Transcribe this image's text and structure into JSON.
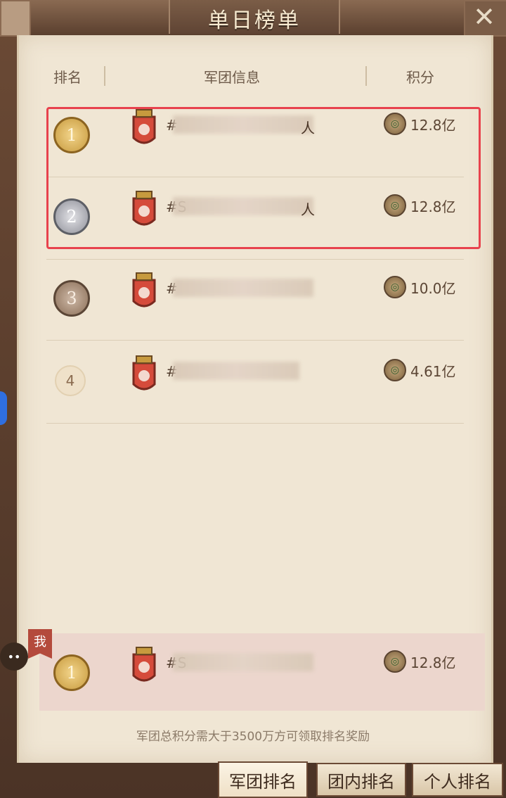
{
  "title": "单日榜单",
  "close_icon": "close-icon",
  "columns": {
    "rank": "排名",
    "info": "军团信息",
    "score": "积分"
  },
  "rows": [
    {
      "rank": "1",
      "name": "#",
      "suffix": "人",
      "score": "12.8亿",
      "medal": "gold"
    },
    {
      "rank": "2",
      "name": "#S",
      "suffix": "人",
      "score": "12.8亿",
      "medal": "silver"
    },
    {
      "rank": "3",
      "name": "#",
      "suffix": "",
      "score": "10.0亿",
      "medal": "bronze"
    },
    {
      "rank": "4",
      "name": "#",
      "suffix": "",
      "score": "4.61亿",
      "medal": "plain"
    }
  ],
  "my_row": {
    "tag": "我",
    "rank": "1",
    "name": "#S",
    "score": "12.8亿"
  },
  "notice": "军团总积分需大于3500万方可领取排名奖励",
  "tabs": [
    "军团排名",
    "团内排名",
    "个人排名"
  ],
  "colors": {
    "highlight": "#e8424d",
    "paper": "#f0e6d4"
  }
}
